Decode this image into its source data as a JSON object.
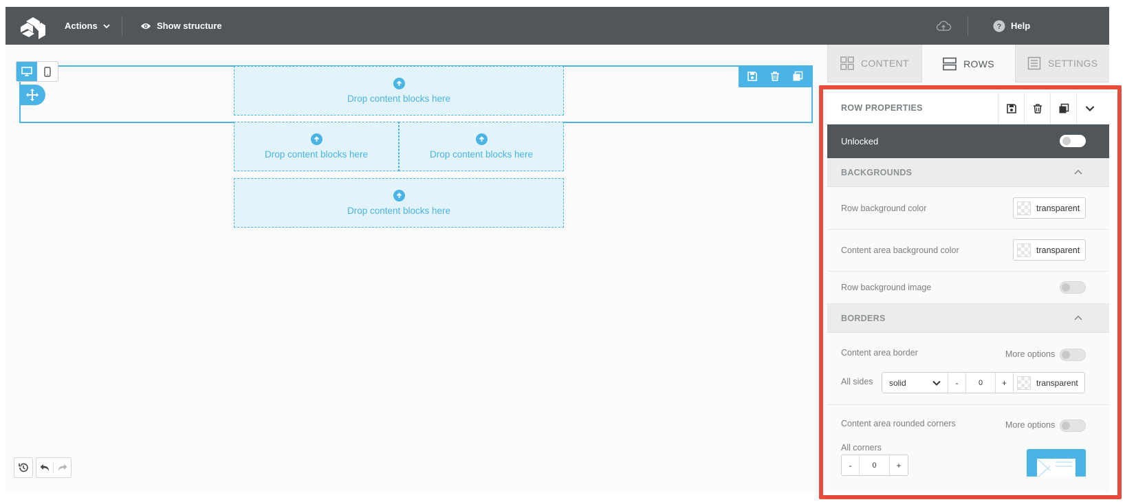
{
  "topbar": {
    "actions_label": "Actions",
    "show_structure_label": "Show structure",
    "help_label": "Help"
  },
  "canvas": {
    "drop_text": "Drop content blocks here"
  },
  "sidebar": {
    "tabs": [
      {
        "label": "CONTENT",
        "active": false
      },
      {
        "label": "ROWS",
        "active": true
      },
      {
        "label": "SETTINGS",
        "active": false
      }
    ],
    "panel": {
      "title": "ROW PROPERTIES",
      "lock_label": "Unlocked",
      "backgrounds": {
        "title": "BACKGROUNDS",
        "row_bg_label": "Row background color",
        "row_bg_value": "transparent",
        "content_bg_label": "Content area background color",
        "content_bg_value": "transparent",
        "row_bg_image_label": "Row background image"
      },
      "borders": {
        "title": "BORDERS",
        "content_border_label": "Content area border",
        "more_options": "More options",
        "all_sides_label": "All sides",
        "style_value": "solid",
        "minus": "-",
        "width_value": "0",
        "plus": "+",
        "color_value": "transparent",
        "rounded_label": "Content area rounded corners",
        "all_corners_label": "All corners",
        "corner_value": "0"
      }
    }
  },
  "colors": {
    "accent": "#4ab4e6",
    "topbar": "#505659",
    "highlight_border": "#e74c3c"
  }
}
